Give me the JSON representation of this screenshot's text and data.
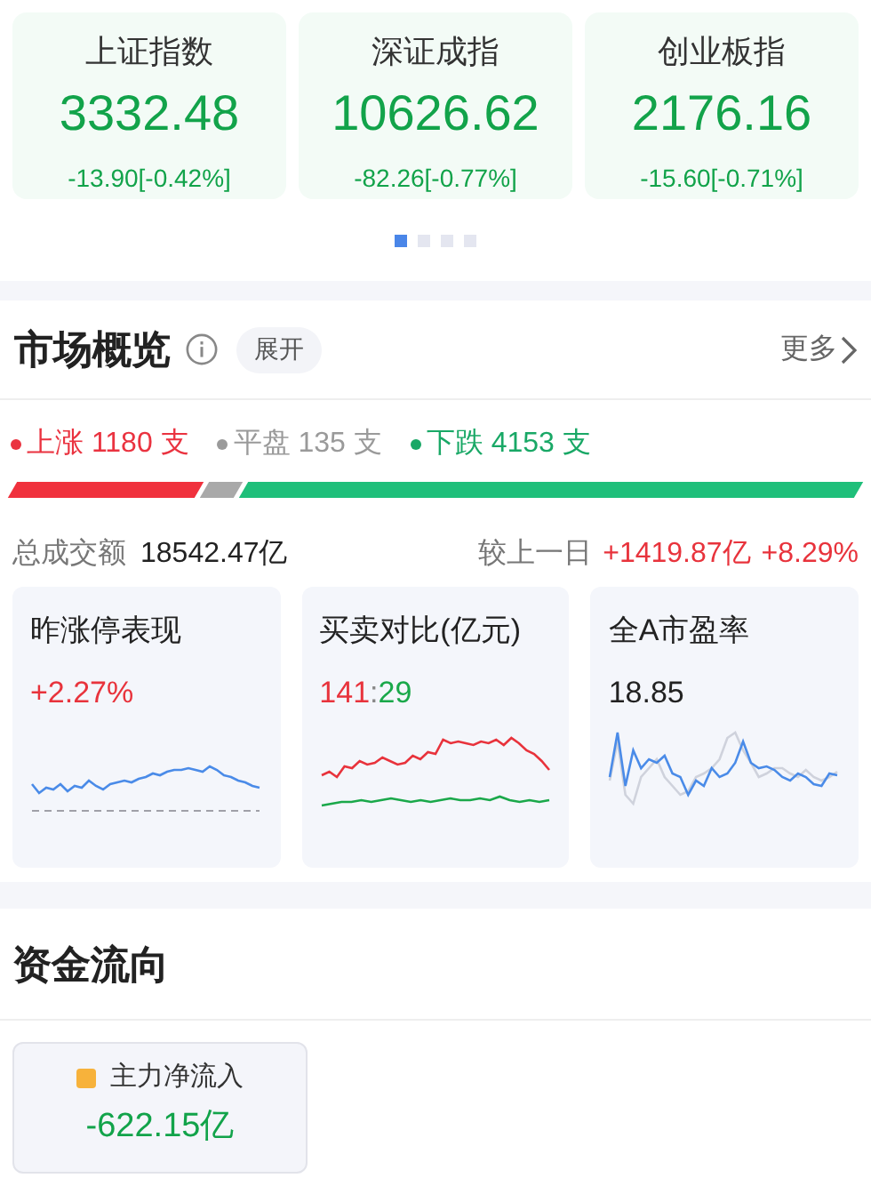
{
  "indices": [
    {
      "name": "上证指数",
      "value": "3332.48",
      "change": "-13.90[-0.42%]"
    },
    {
      "name": "深证成指",
      "value": "10626.62",
      "change": "-82.26[-0.77%]"
    },
    {
      "name": "创业板指",
      "value": "2176.16",
      "change": "-15.60[-0.71%]"
    }
  ],
  "pager": [
    {
      "selected": true
    },
    {
      "selected": false
    },
    {
      "selected": false
    },
    {
      "selected": false
    }
  ],
  "overview": {
    "title": "市场概览",
    "expand": "展开",
    "more": "更多",
    "breadth": [
      {
        "kind": "up",
        "label": "上涨 1180 支"
      },
      {
        "kind": "flat",
        "label": "平盘 135 支"
      },
      {
        "kind": "down",
        "label": "下跌 4153 支"
      }
    ],
    "turnover_label": "总成交额",
    "turnover": "18542.47亿",
    "compare_label": "较上一日",
    "compare_amount": "+1419.87亿",
    "compare_pct": "+8.29%",
    "cards": [
      {
        "kind": "limit",
        "title": "昨涨停表现",
        "value": "+2.27%"
      },
      {
        "kind": "ratio",
        "title": "买卖对比(亿元)",
        "buy": "141",
        "sep": ":",
        "sell": "29"
      },
      {
        "kind": "pe",
        "title": "全A市盈率",
        "value": "18.85"
      }
    ]
  },
  "flow": {
    "title": "资金流向",
    "legend": "主力净流入",
    "value": "-622.15亿",
    "color": "#f7b23b"
  }
}
